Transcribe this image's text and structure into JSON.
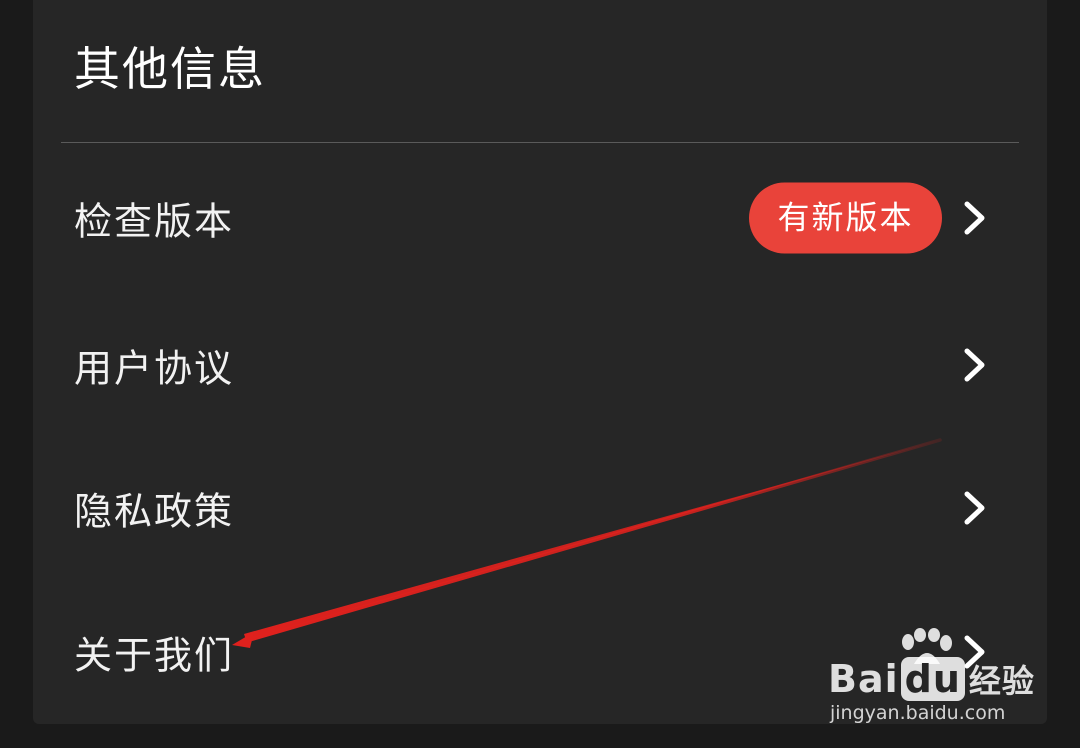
{
  "section": {
    "title": "其他信息"
  },
  "items": [
    {
      "label": "检查版本",
      "badge": "有新版本",
      "icon": "chevron-right-icon"
    },
    {
      "label": "用户协议",
      "icon": "chevron-right-icon"
    },
    {
      "label": "隐私政策",
      "icon": "chevron-right-icon"
    },
    {
      "label": "关于我们",
      "icon": "chevron-right-icon"
    }
  ],
  "annotation": {
    "icon": "red-arrow-icon",
    "color": "#e0211d"
  },
  "watermark": {
    "brand_bai": "Bai",
    "brand_du": "du",
    "brand_cn": "经验",
    "url": "jingyan.baidu.com",
    "icon": "baidu-paw-icon"
  },
  "colors": {
    "background": "#1a1a1a",
    "card": "#262626",
    "badge": "#e9433a",
    "text": "#f2f2f2"
  }
}
